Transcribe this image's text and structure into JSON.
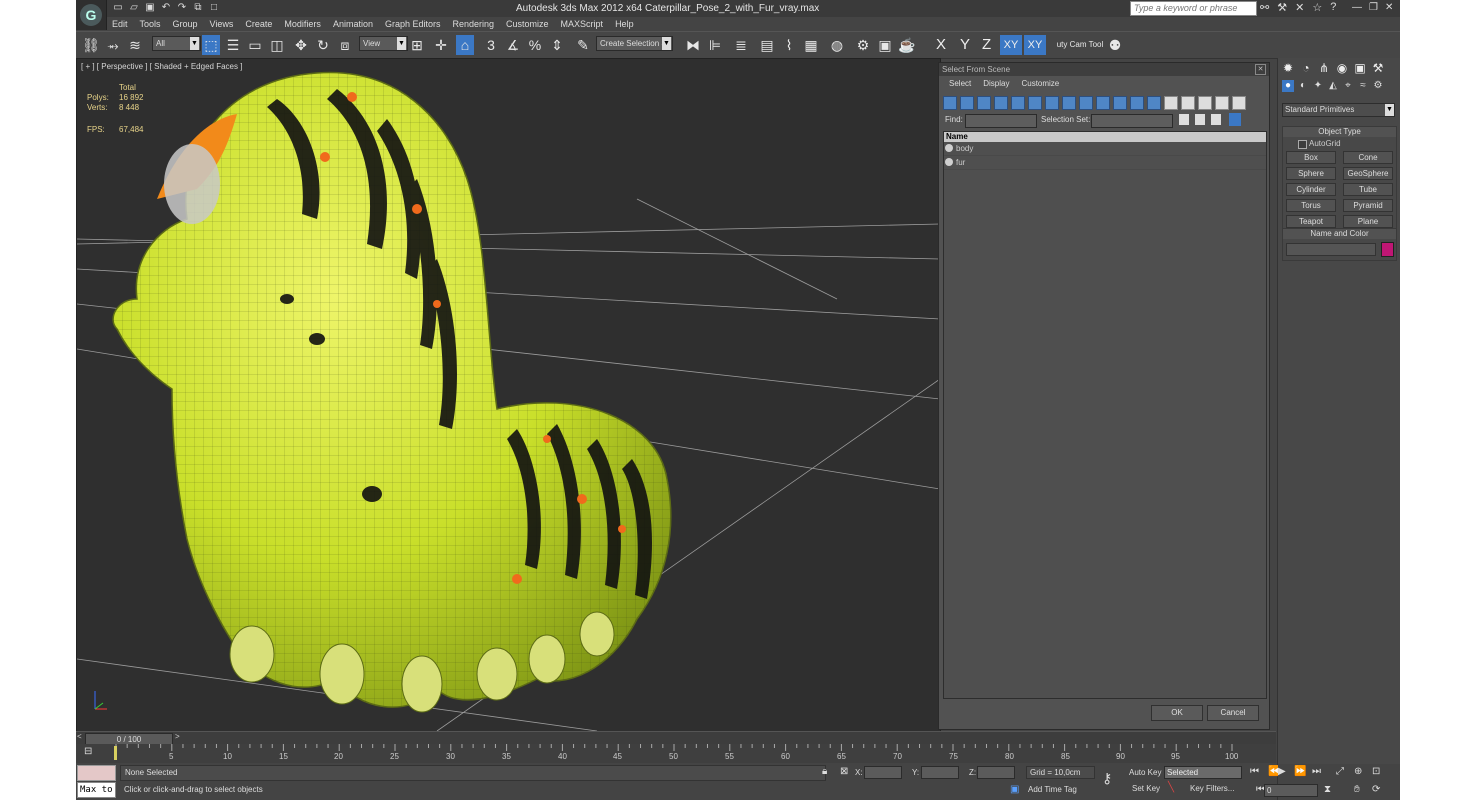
{
  "window": {
    "title": "Autodesk 3ds Max  2012 x64      Caterpillar_Pose_2_with_Fur_vray.max",
    "search_placeholder": "Type a keyword or phrase"
  },
  "menu": [
    "Edit",
    "Tools",
    "Group",
    "Views",
    "Create",
    "Modifiers",
    "Animation",
    "Graph Editors",
    "Rendering",
    "Customize",
    "MAXScript",
    "Help"
  ],
  "toolbar": {
    "selection_filter": "All",
    "ref_coord": "View",
    "named_selection": "Create Selection Se",
    "axes": [
      "X",
      "Y",
      "Z",
      "XY",
      "XY"
    ],
    "snap_label": "3",
    "angle_snap_label": "%",
    "plugin_label": "uty Cam Tool v"
  },
  "viewport": {
    "label": "[ + ] [ Perspective ] [ Shaded + Edged Faces ]",
    "stats": {
      "total_label": "Total",
      "polys_label": "Polys:",
      "polys_value": "16 892",
      "verts_label": "Verts:",
      "verts_value": "8 448",
      "fps_label": "FPS:",
      "fps_value": "67,484"
    }
  },
  "select_dialog": {
    "title": "Select From Scene",
    "menu": [
      "Select",
      "Display",
      "Customize"
    ],
    "find_label": "Find:",
    "selection_set_label": "Selection Set:",
    "column_name": "Name",
    "objects": [
      "body",
      "fur"
    ],
    "ok_label": "OK",
    "cancel_label": "Cancel"
  },
  "command_panel": {
    "category": "Standard Primitives",
    "object_type_title": "Object Type",
    "autogrid_label": "AutoGrid",
    "primitives": [
      "Box",
      "Cone",
      "Sphere",
      "GeoSphere",
      "Cylinder",
      "Tube",
      "Torus",
      "Pyramid",
      "Teapot",
      "Plane"
    ],
    "name_color_title": "Name and Color",
    "object_color": "#c01674"
  },
  "timeline": {
    "frame_display": "0 / 100",
    "ticks": [
      "5",
      "10",
      "15",
      "20",
      "25",
      "30",
      "35",
      "40",
      "45",
      "50",
      "55",
      "60",
      "65",
      "70",
      "75",
      "80",
      "85",
      "90",
      "95",
      "100"
    ]
  },
  "status": {
    "maxscript_label": "Max to",
    "selection_status": "None Selected",
    "prompt": "Click or click-and-drag to select objects",
    "x_label": "X:",
    "y_label": "Y:",
    "z_label": "Z:",
    "grid": "Grid = 10,0cm",
    "add_time_tag": "Add Time Tag",
    "auto_key": "Auto Key",
    "set_key": "Set Key",
    "key_mode": "Selected",
    "key_filters": "Key Filters...",
    "current_frame": "0"
  }
}
